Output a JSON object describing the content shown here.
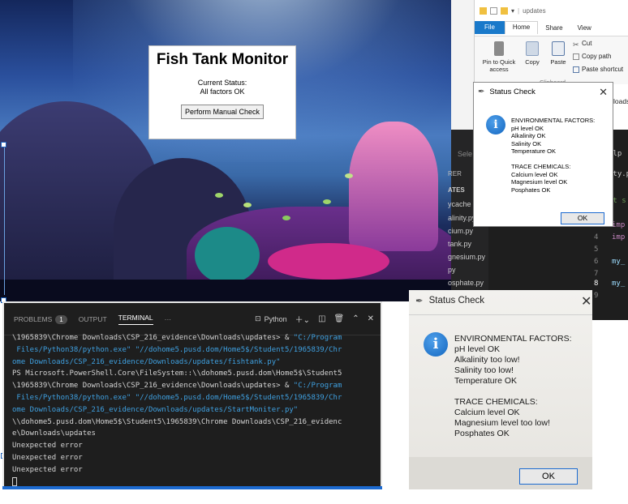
{
  "app_window": {
    "title": "Fish Tank Monitor",
    "status_label": "Current Status:",
    "status_value": "All factors OK",
    "button_label": "Perform Manual Check"
  },
  "explorer": {
    "path": "updates",
    "tabs": [
      "File",
      "Home",
      "Share",
      "View"
    ],
    "ribbon": {
      "pin_label_1": "Pin to Quick",
      "pin_label_2": "access",
      "copy": "Copy",
      "paste": "Paste",
      "cut": "Cut",
      "copy_path": "Copy path",
      "paste_shortcut": "Paste shortcut",
      "clipboard": "Clipboard"
    }
  },
  "status_dialog": {
    "title": "Status Check",
    "lines": "ENVIRONMENTAL FACTORS:\npH level OK\nAlkalinity OK\nSalinity OK\nTemperature OK\n\nTRACE CHEMICALS:\nCalcium level OK\nMagnesium level OK\nPosphates OK",
    "ok": "OK"
  },
  "photo_dialog": {
    "title": "Status Check",
    "lines": "ENVIRONMENTAL FACTORS:\npH level OK\nAlkalinity too low!\nSalinity too low!\nTemperature OK\n\nTRACE CHEMICALS:\nCalcium level OK\nMagnesium level too low!\nPosphates OK",
    "ok": "OK"
  },
  "vscode_explorer": {
    "header": "RER",
    "section": "ATES",
    "select": "Sele",
    "files": [
      "ycache",
      "alinity.py",
      "cium.py",
      "tank.py",
      "gnesium.py",
      "py",
      "osphate.py"
    ],
    "loads": "loads",
    "sche": "sche",
    "elp": "elp",
    "line_numbers": [
      "3",
      "4",
      "5",
      "6",
      "7",
      "8",
      "9"
    ],
    "code": [
      "imp",
      "imp",
      "my_",
      "my_"
    ],
    "ity": "ity.p",
    "at": "at s"
  },
  "terminal": {
    "tabs": {
      "problems": "PROBLEMS",
      "problems_count": "1",
      "output": "OUTPUT",
      "terminal": "TERMINAL",
      "more": "···"
    },
    "shell": "Python",
    "lines": [
      {
        "a": "\\1965839\\Chrome Downloads\\CSP_216_evidence\\Downloads\\updates> & ",
        "b": "\"C:/Program"
      },
      {
        "a": "",
        "b": " Files/Python38/python.exe\" \"//dohome5.pusd.dom/Home5$/Student5/1965839/Chr"
      },
      {
        "a": "",
        "b": "ome Downloads/CSP_216_evidence/Downloads/updates/fishtank.py\""
      },
      {
        "a": "PS Microsoft.PowerShell.Core\\FileSystem::\\\\dohome5.pusd.dom\\Home5$\\Student5",
        "b": ""
      },
      {
        "a": "\\1965839\\Chrome Downloads\\CSP_216_evidence\\Downloads\\updates> & ",
        "b": "\"C:/Program"
      },
      {
        "a": "",
        "b": " Files/Python38/python.exe\" \"//dohome5.pusd.dom/Home5$/Student5/1965839/Chr"
      },
      {
        "a": "",
        "b": "ome Downloads/CSP_216_evidence/Downloads/updates/StartMoniter.py\""
      },
      {
        "a": "\\\\dohome5.pusd.dom\\Home5$\\Student5\\1965839\\Chrome Downloads\\CSP_216_evidenc",
        "b": ""
      },
      {
        "a": "e\\Downloads\\updates",
        "b": ""
      },
      {
        "a": "Unexpected error",
        "b": ""
      },
      {
        "a": "Unexpected error",
        "b": ""
      },
      {
        "a": "Unexpected error",
        "b": ""
      }
    ]
  },
  "colors": {
    "accent": "#1979ca",
    "terminal_bg": "#1e1e1e",
    "string": "#3fa0e0"
  }
}
